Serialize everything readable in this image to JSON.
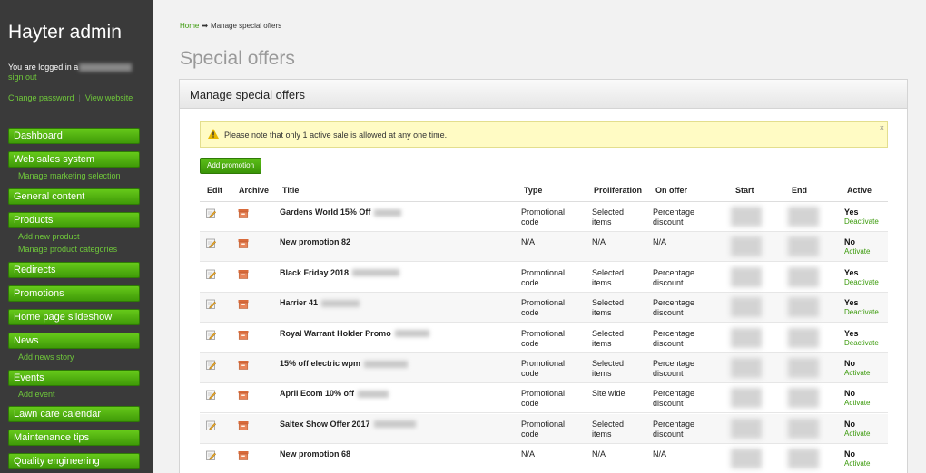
{
  "sidebar": {
    "brand": "Hayter admin",
    "logged_in_text": "You are logged in a",
    "sign_out": "sign out",
    "change_password": "Change password",
    "view_website": "View website",
    "nav": [
      {
        "label": "Dashboard"
      },
      {
        "label": "Web sales system",
        "sub": [
          "Manage marketing selection"
        ]
      },
      {
        "label": "General content"
      },
      {
        "label": "Products",
        "sub": [
          "Add new product",
          "Manage product categories"
        ]
      },
      {
        "label": "Redirects"
      },
      {
        "label": "Promotions"
      },
      {
        "label": "Home page slideshow"
      },
      {
        "label": "News",
        "sub": [
          "Add news story"
        ]
      },
      {
        "label": "Events",
        "sub": [
          "Add event"
        ]
      },
      {
        "label": "Lawn care calendar"
      },
      {
        "label": "Maintenance tips"
      },
      {
        "label": "Quality engineering"
      }
    ]
  },
  "breadcrumb": {
    "home": "Home",
    "arrow": "➡",
    "current": "Manage special offers"
  },
  "page_title": "Special offers",
  "panel": {
    "title": "Manage special offers",
    "alert": "Please note that only 1 active sale is allowed at any one time.",
    "close": "×",
    "add_button": "Add promotion"
  },
  "table": {
    "columns": [
      "Edit",
      "Archive",
      "Title",
      "Type",
      "Proliferation",
      "On offer",
      "Start",
      "End",
      "Active"
    ],
    "rows": [
      {
        "title": "Gardens World 15% Off",
        "type": [
          "Promotional",
          "code"
        ],
        "prolif": [
          "Selected",
          "items"
        ],
        "offer": [
          "Percentage",
          "discount"
        ],
        "active": "Yes",
        "action": "Deactivate"
      },
      {
        "title": "New promotion 82",
        "type": [
          "N/A",
          ""
        ],
        "prolif": [
          "N/A",
          ""
        ],
        "offer": [
          "N/A",
          ""
        ],
        "active": "No",
        "action": "Activate"
      },
      {
        "title": "Black Friday 2018",
        "type": [
          "Promotional",
          "code"
        ],
        "prolif": [
          "Selected",
          "items"
        ],
        "offer": [
          "Percentage",
          "discount"
        ],
        "active": "Yes",
        "action": "Deactivate"
      },
      {
        "title": "Harrier 41",
        "type": [
          "Promotional",
          "code"
        ],
        "prolif": [
          "Selected",
          "items"
        ],
        "offer": [
          "Percentage",
          "discount"
        ],
        "active": "Yes",
        "action": "Deactivate"
      },
      {
        "title": "Royal Warrant Holder Promo",
        "type": [
          "Promotional",
          "code"
        ],
        "prolif": [
          "Selected",
          "items"
        ],
        "offer": [
          "Percentage",
          "discount"
        ],
        "active": "Yes",
        "action": "Deactivate"
      },
      {
        "title": "15% off electric wpm",
        "type": [
          "Promotional",
          "code"
        ],
        "prolif": [
          "Selected",
          "items"
        ],
        "offer": [
          "Percentage",
          "discount"
        ],
        "active": "No",
        "action": "Activate"
      },
      {
        "title": "April Ecom 10% off",
        "type": [
          "Promotional",
          "code"
        ],
        "prolif": [
          "Site wide",
          ""
        ],
        "offer": [
          "Percentage",
          "discount"
        ],
        "active": "No",
        "action": "Activate"
      },
      {
        "title": "Saltex Show Offer 2017",
        "type": [
          "Promotional",
          "code"
        ],
        "prolif": [
          "Selected",
          "items"
        ],
        "offer": [
          "Percentage",
          "discount"
        ],
        "active": "No",
        "action": "Activate"
      },
      {
        "title": "New promotion 68",
        "type": [
          "N/A",
          ""
        ],
        "prolif": [
          "N/A",
          ""
        ],
        "offer": [
          "N/A",
          ""
        ],
        "active": "No",
        "action": "Activate"
      }
    ]
  },
  "icons": {
    "edit": "edit-icon",
    "archive": "archive-icon",
    "warning": "warning-icon"
  },
  "colors": {
    "accent": "#4fae12",
    "sidebar": "#3a3a3a",
    "link": "#3a9a0a"
  }
}
